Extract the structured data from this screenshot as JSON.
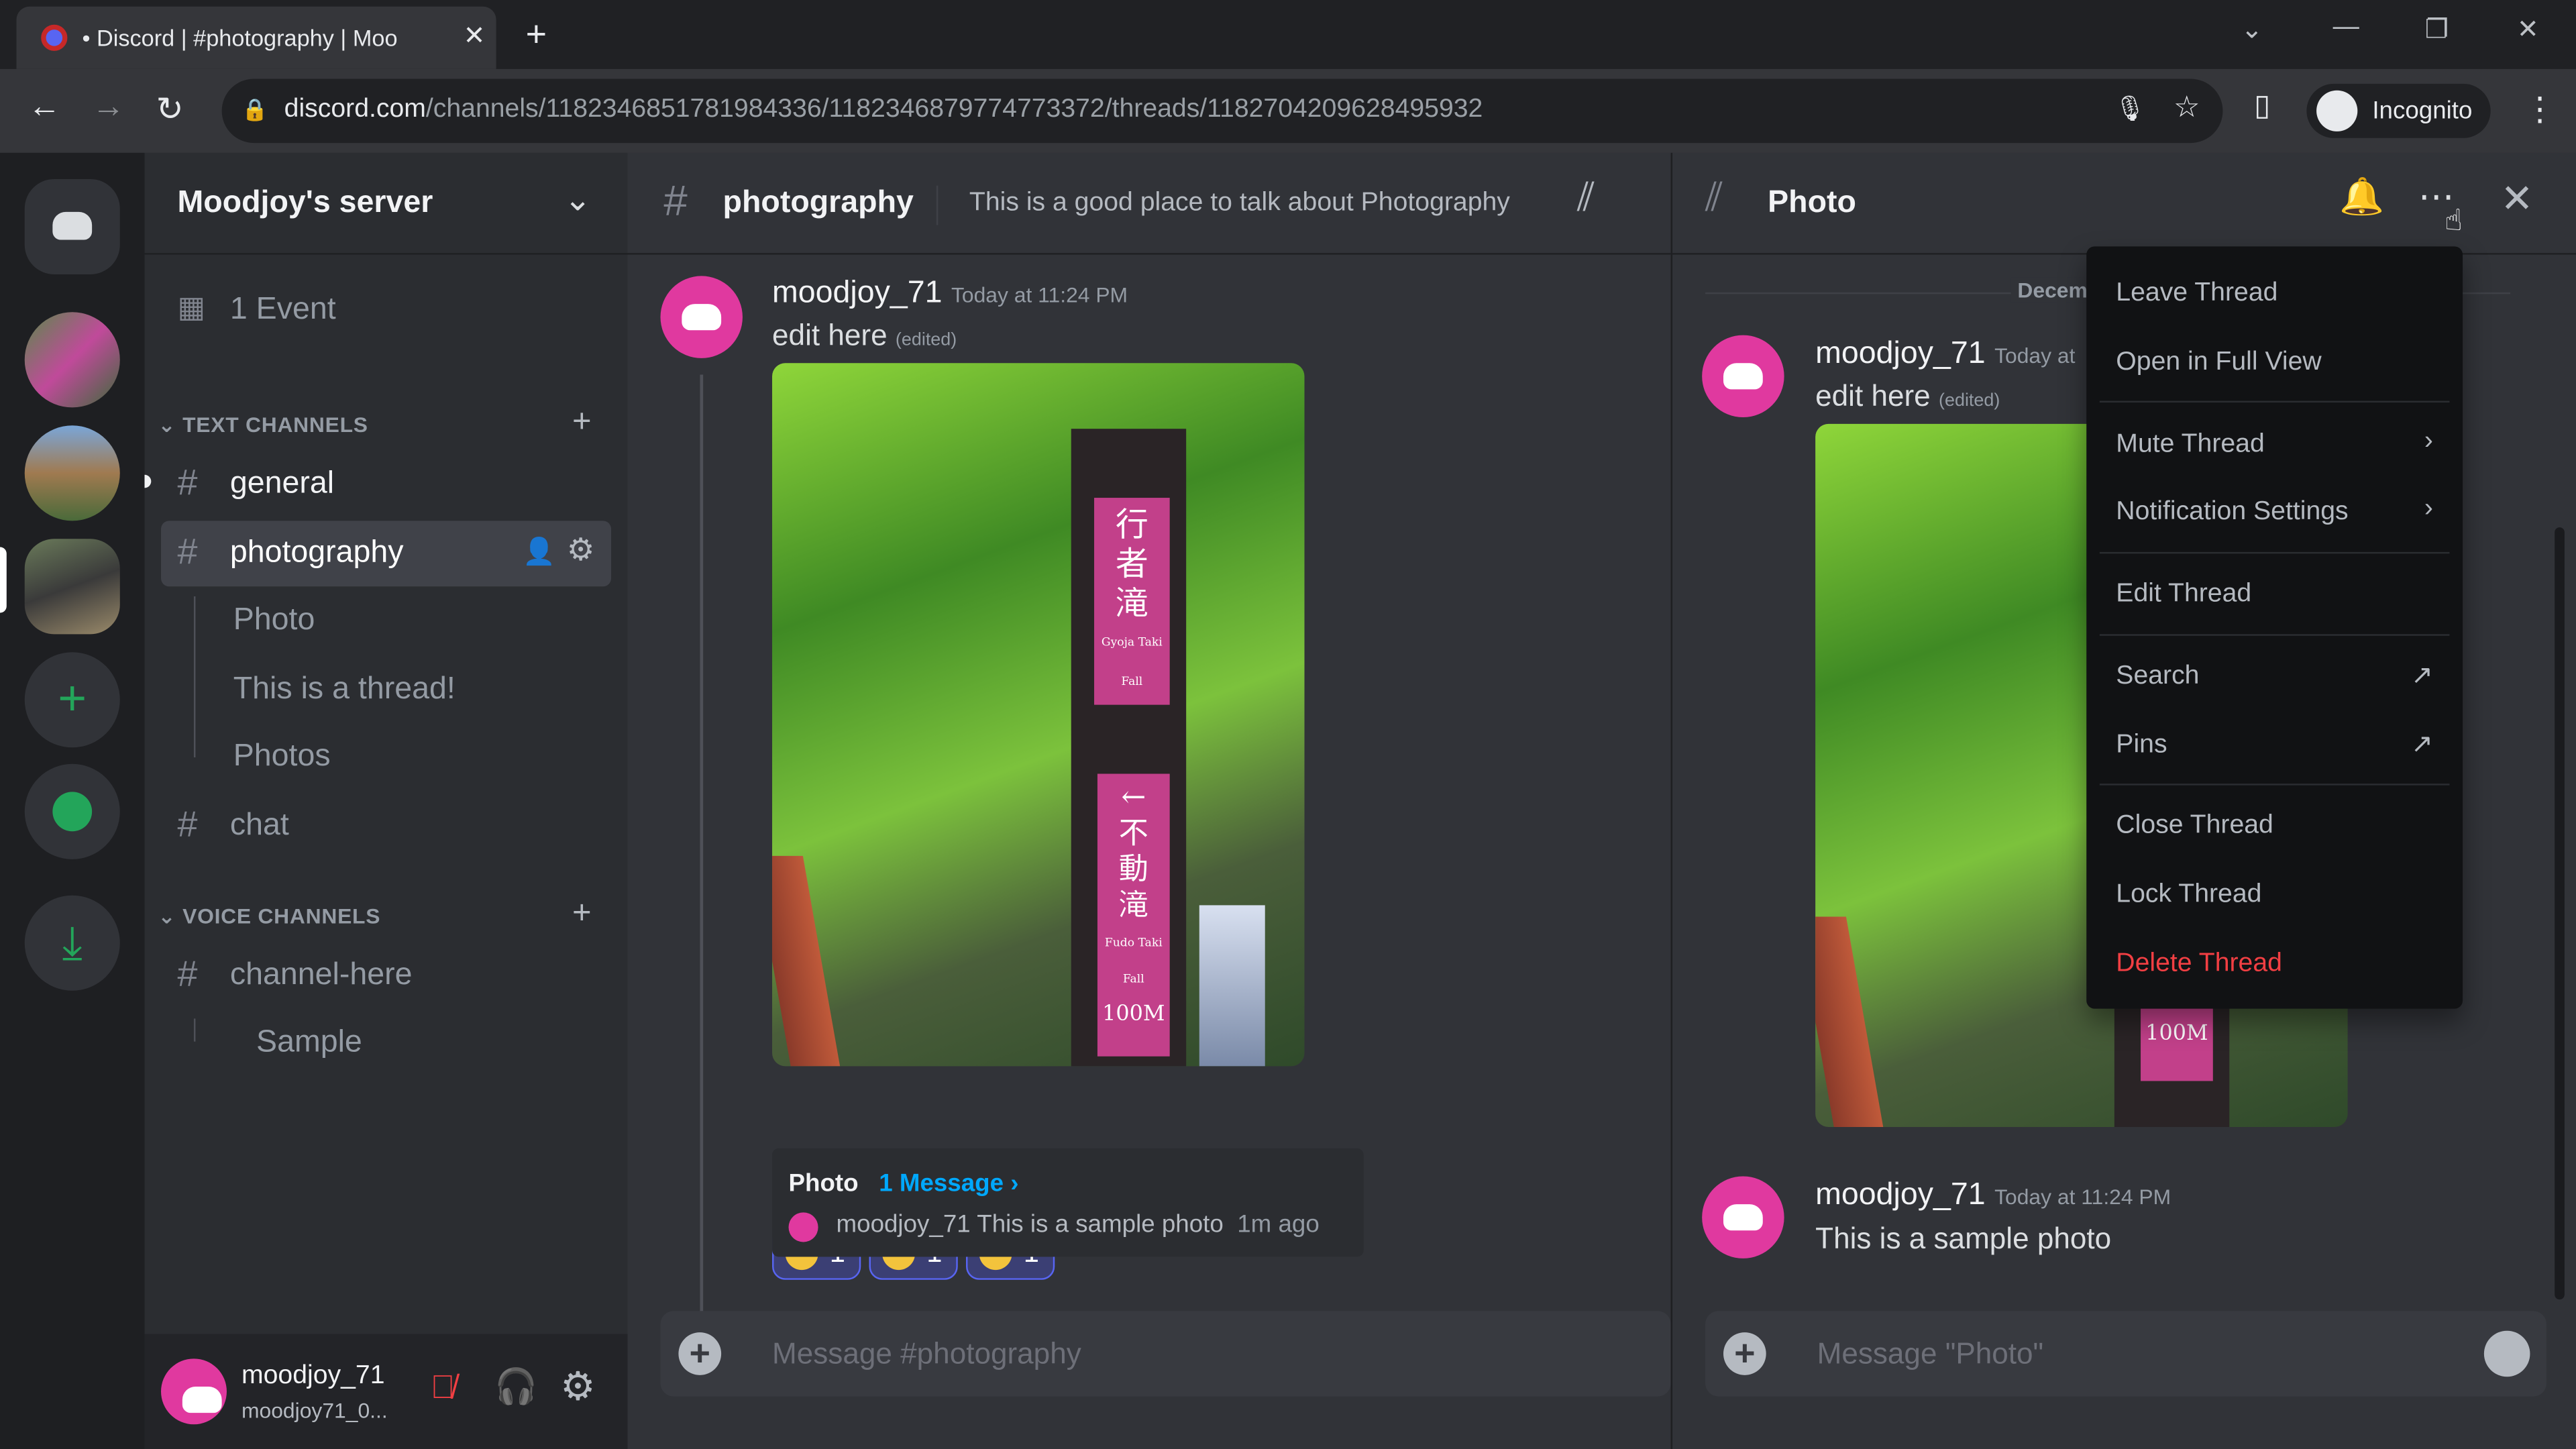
{
  "browser": {
    "tab_title": "• Discord | #photography | Moo",
    "url_domain": "discord.com",
    "url_path": "/channels/1182346851781984336/1182346879774773372/threads/1182704209628495932",
    "profile_label": "Incognito"
  },
  "server": {
    "name": "Moodjoy's server",
    "events": "1 Event"
  },
  "sidebar": {
    "text_category": "TEXT CHANNELS",
    "voice_category": "VOICE CHANNELS",
    "channels": [
      {
        "label": "general"
      },
      {
        "label": "photography"
      }
    ],
    "threads": [
      {
        "label": "Photo"
      },
      {
        "label": "This is a thread!"
      },
      {
        "label": "Photos"
      }
    ],
    "chat": "chat",
    "voice": [
      {
        "label": "channel-here"
      }
    ],
    "voice_thread": "Sample"
  },
  "user_panel": {
    "name": "moodjoy_71",
    "tag": "moodjoy71_0..."
  },
  "main": {
    "channel": "photography",
    "topic": "This is a good place to talk about Photography",
    "message": {
      "author": "moodjoy_71",
      "time": "Today at 11:24 PM",
      "text": "edit here",
      "edited": "(edited)"
    },
    "sign_text": "Gyoja Taki Fall",
    "sign_text2": "Fudo Taki Fall",
    "sign_dist": "100M",
    "reactions": [
      {
        "emoji": "yum",
        "count": "1"
      },
      {
        "emoji": "pleading",
        "count": "1"
      },
      {
        "emoji": "innocent",
        "count": "1"
      }
    ],
    "thread_preview": {
      "name": "Photo",
      "count": "1 Message ›",
      "author": "moodjoy_71",
      "text": "This is a sample photo",
      "time": "1m ago"
    },
    "composer_placeholder": "Message #photography"
  },
  "thread_panel": {
    "title": "Photo",
    "date_divider": "Decem",
    "msg1": {
      "author": "moodjoy_71",
      "time": "Today at",
      "text": "edit here",
      "edited": "(edited)"
    },
    "msg2": {
      "author": "moodjoy_71",
      "time": "Today at 11:24 PM",
      "text": "This is a sample photo"
    },
    "composer_placeholder": "Message \"Photo\""
  },
  "context_menu": {
    "items": [
      {
        "label": "Leave Thread"
      },
      {
        "label": "Open in Full View"
      },
      {
        "label": "Mute Thread"
      },
      {
        "label": "Notification Settings"
      },
      {
        "label": "Edit Thread"
      },
      {
        "label": "Search"
      },
      {
        "label": "Pins"
      },
      {
        "label": "Close Thread"
      },
      {
        "label": "Lock Thread"
      },
      {
        "label": "Delete Thread"
      }
    ]
  },
  "colors": {
    "accent": "#5865f2",
    "danger": "#f23f43",
    "link": "#00a8fc",
    "avatar": "#e0399f"
  }
}
